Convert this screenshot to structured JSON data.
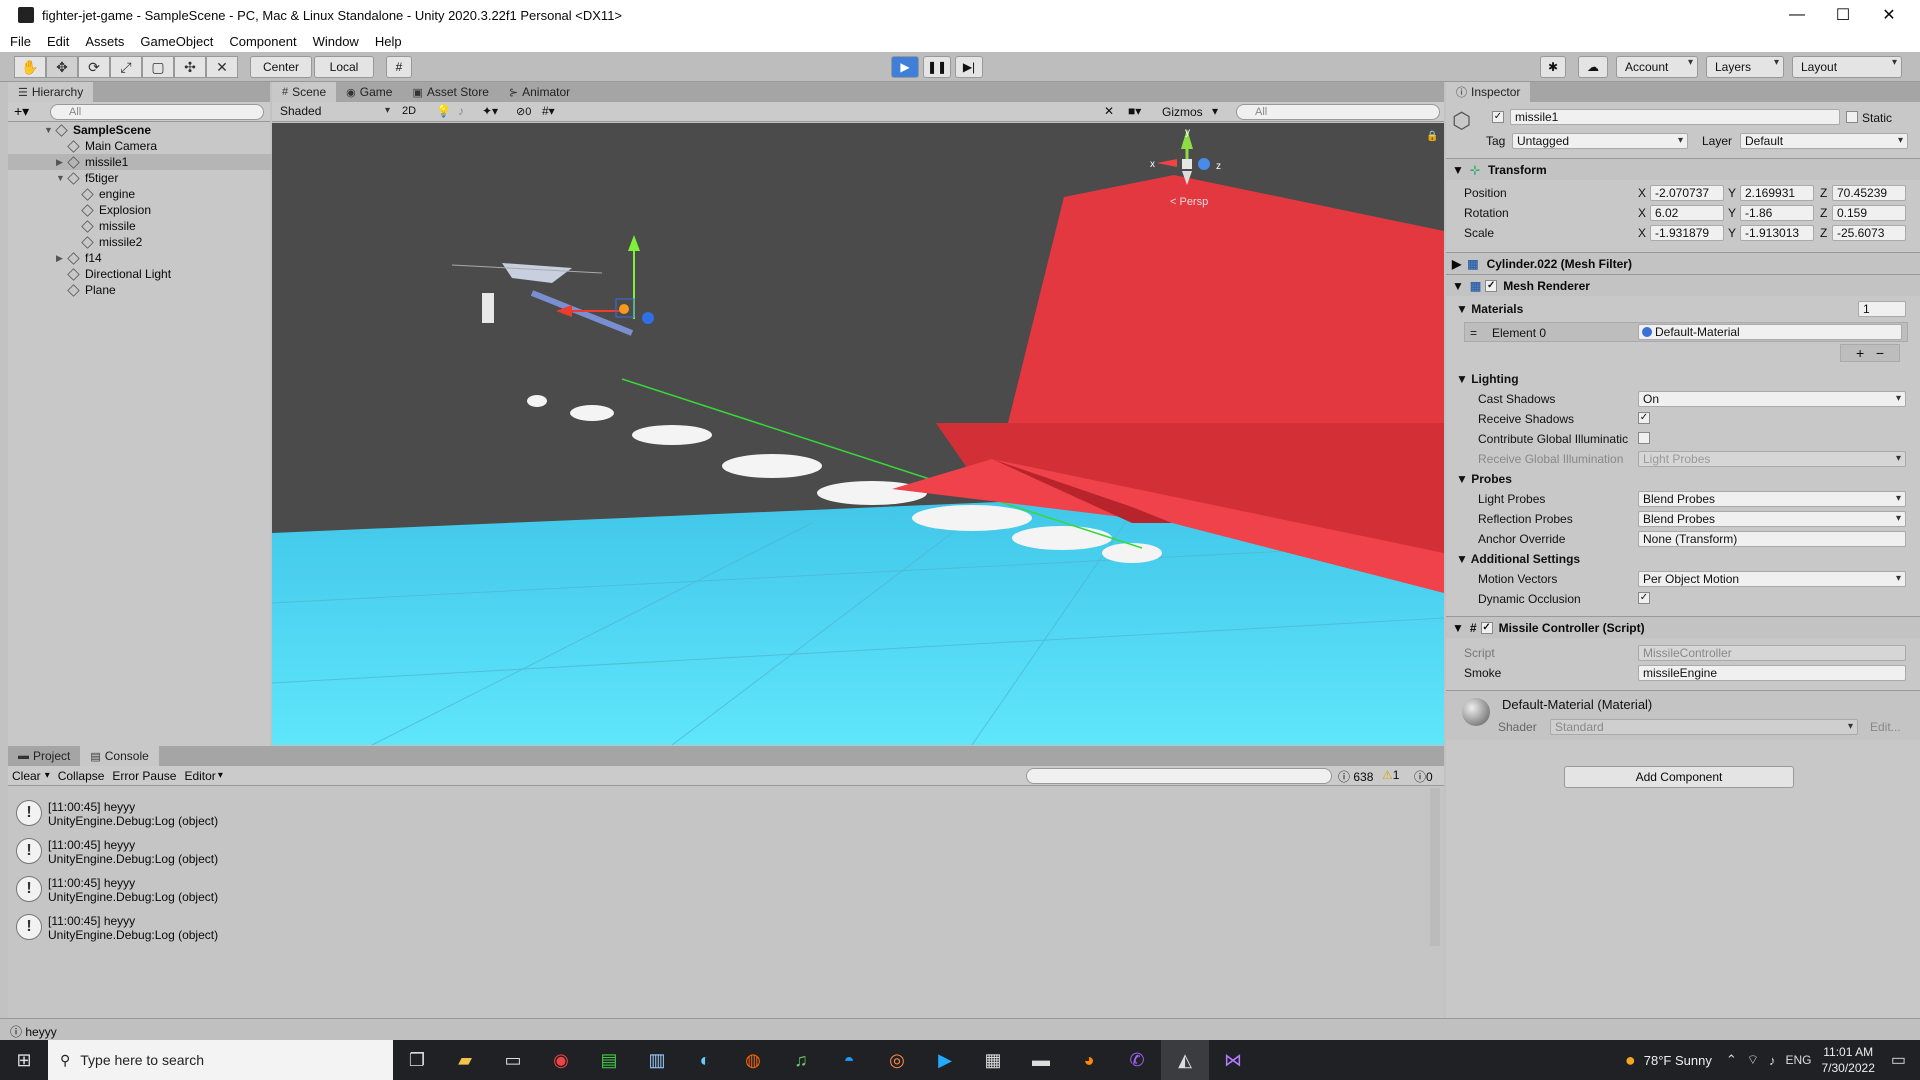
{
  "window": {
    "title": "fighter-jet-game - SampleScene - PC, Mac & Linux Standalone - Unity 2020.3.22f1 Personal <DX11>",
    "min": "—",
    "max": "☐",
    "close": "✕"
  },
  "menu": [
    "File",
    "Edit",
    "Assets",
    "GameObject",
    "Component",
    "Window",
    "Help"
  ],
  "toolbar": {
    "center": "Center",
    "local": "Local",
    "account": "Account",
    "layers": "Layers",
    "layout": "Layout"
  },
  "hierarchy": {
    "tab": "Hierarchy",
    "search_placeholder": "All",
    "items": [
      {
        "label": "SampleScene"
      },
      {
        "label": "Main Camera"
      },
      {
        "label": "missile1"
      },
      {
        "label": "f5tiger"
      },
      {
        "label": "engine"
      },
      {
        "label": "Explosion"
      },
      {
        "label": "missile"
      },
      {
        "label": "missile2"
      },
      {
        "label": "f14"
      },
      {
        "label": "Directional Light"
      },
      {
        "label": "Plane"
      }
    ]
  },
  "scene": {
    "tabs": [
      "Scene",
      "Game",
      "Asset Store",
      "Animator"
    ],
    "shading": "Shaded",
    "mode2d": "2D",
    "fx_count": "0",
    "gizmos": "Gizmos",
    "search_placeholder": "All",
    "persp": "< Persp",
    "axis_x": "x",
    "axis_y": "y",
    "axis_z": "z"
  },
  "console": {
    "tabs": [
      "Project",
      "Console"
    ],
    "buttons": [
      "Clear",
      "Collapse",
      "Error Pause",
      "Editor"
    ],
    "counts": {
      "info": "638",
      "warn": "1",
      "error": "0"
    },
    "logs": [
      {
        "line1": "[11:00:45] heyyy",
        "line2": "UnityEngine.Debug:Log (object)"
      },
      {
        "line1": "[11:00:45] heyyy",
        "line2": "UnityEngine.Debug:Log (object)"
      },
      {
        "line1": "[11:00:45] heyyy",
        "line2": "UnityEngine.Debug:Log (object)"
      },
      {
        "line1": "[11:00:45] heyyy",
        "line2": "UnityEngine.Debug:Log (object)"
      }
    ],
    "status": "heyyy"
  },
  "inspector": {
    "tab": "Inspector",
    "object_name": "missile1",
    "static": "Static",
    "tag_label": "Tag",
    "tag": "Untagged",
    "layer_label": "Layer",
    "layer": "Default",
    "transform": {
      "title": "Transform",
      "position": {
        "label": "Position",
        "x": "-2.070737",
        "y": "2.169931",
        "z": "70.45239"
      },
      "rotation": {
        "label": "Rotation",
        "x": "6.02",
        "y": "-1.86",
        "z": "0.159"
      },
      "scale": {
        "label": "Scale",
        "x": "-1.931879",
        "y": "-1.913013",
        "z": "-25.6073"
      }
    },
    "mesh_filter": "Cylinder.022 (Mesh Filter)",
    "mesh_renderer": "Mesh Renderer",
    "materials": {
      "label": "Materials",
      "count": "1",
      "element_label": "Element 0",
      "element_value": "Default-Material"
    },
    "lighting": {
      "label": "Lighting",
      "cast_shadows_label": "Cast Shadows",
      "cast_shadows": "On",
      "receive_shadows_label": "Receive Shadows",
      "contribute_gi_label": "Contribute Global Illuminatic",
      "receive_gi_label": "Receive Global Illumination",
      "receive_gi": "Light Probes"
    },
    "probes": {
      "label": "Probes",
      "light_probes_label": "Light Probes",
      "light_probes": "Blend Probes",
      "reflection_probes_label": "Reflection Probes",
      "reflection_probes": "Blend Probes",
      "anchor_label": "Anchor Override",
      "anchor": "None (Transform)"
    },
    "additional": {
      "label": "Additional Settings",
      "motion_vectors_label": "Motion Vectors",
      "motion_vectors": "Per Object Motion",
      "dynamic_occlusion_label": "Dynamic Occlusion"
    },
    "script_component": {
      "title": "Missile Controller (Script)",
      "script_label": "Script",
      "script": "MissileController",
      "smoke_label": "Smoke",
      "smoke": "missileEngine"
    },
    "material": {
      "title": "Default-Material (Material)",
      "shader_label": "Shader",
      "shader": "Standard",
      "edit": "Edit..."
    },
    "add_component": "Add Component"
  },
  "taskbar": {
    "search_placeholder": "Type here to search",
    "weather": "78°F  Sunny",
    "lang": "ENG",
    "time": "11:01 AM",
    "date": "7/30/2022"
  }
}
